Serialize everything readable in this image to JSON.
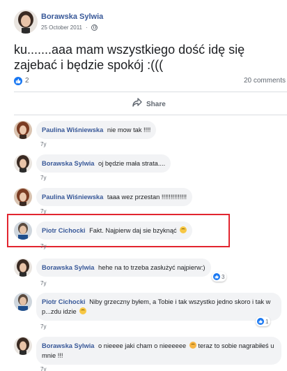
{
  "post": {
    "author": "Borawska Sylwia",
    "date": "25 October 2011",
    "privacy_icon": "globe-icon",
    "text": "ku.......aaa mam wszystkiego dość idę się zajebać i będzie spokój :(((",
    "like_count": "2",
    "comments_count": "20 comments",
    "share_label": "Share"
  },
  "comments": [
    {
      "author": "Paulina Wiśniewska",
      "text": "nie mow tak !!!!",
      "time": "7y"
    },
    {
      "author": "Borawska Sylwia",
      "text": "oj będzie mała strata....",
      "time": "7y"
    },
    {
      "author": "Paulina Wiśniewska",
      "text": "taaa wez przestan !!!!!!!!!!!!!!",
      "time": "7y"
    },
    {
      "author": "Piotr Cichocki",
      "text": "Fakt. Najpierw daj sie bzyknąć",
      "time": "7y"
    },
    {
      "author": "Borawska Sylwia",
      "text": "hehe na to trzeba zasłużyć najpierw:)",
      "time": "7y",
      "likes": "3"
    },
    {
      "author": "Piotr Cichocki",
      "text": "Niby grzeczny byłem, a Tobie i tak wszystko jedno skoro i tak w p...zdu idzie",
      "time": "7y",
      "likes": "1"
    },
    {
      "author": "Borawska Sylwia",
      "text": "o nieeee jaki cham o nieeeeee",
      "text2": "teraz to sobie nagrabiłeś u mnie !!!",
      "time": "7y"
    }
  ],
  "colors": {
    "link": "#385898",
    "like_blue": "#1877f2",
    "highlight": "#e2252f",
    "bubble": "#f2f3f5"
  }
}
